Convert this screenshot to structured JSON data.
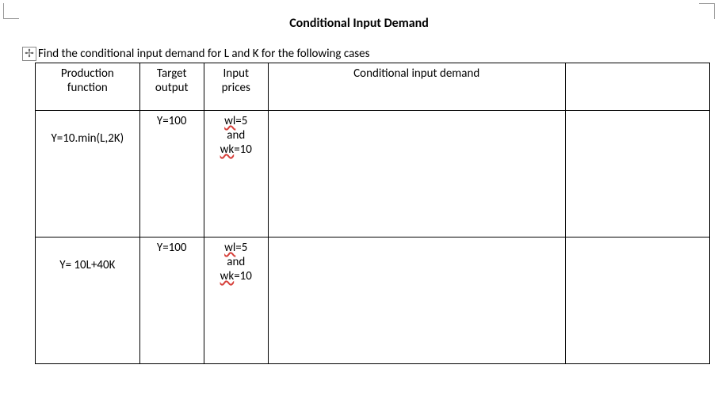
{
  "title": "Conditional Input Demand",
  "intro": "Find the conditional input demand for L and K for the following cases",
  "table": {
    "headers": {
      "col1_line1": "Production",
      "col1_line2": "function",
      "col2_line1": "Target",
      "col2_line2": "output",
      "col3_line1": "Input",
      "col3_line2": "prices",
      "col4": "Conditional input demand",
      "col5": ""
    },
    "rows": [
      {
        "production": "Y=10.min(L,2K)",
        "target": "Y=100",
        "wl_label": "wl",
        "wl_val": "=5",
        "and": "and",
        "wk_label": "wk",
        "wk_val": "=10",
        "demand": "",
        "extra": ""
      },
      {
        "production": "Y= 10L+40K",
        "target": "Y=100",
        "wl_label": "wl",
        "wl_val": "=5",
        "and": "and",
        "wk_label": "wk",
        "wk_val": "=10",
        "demand": "",
        "extra": ""
      }
    ]
  }
}
